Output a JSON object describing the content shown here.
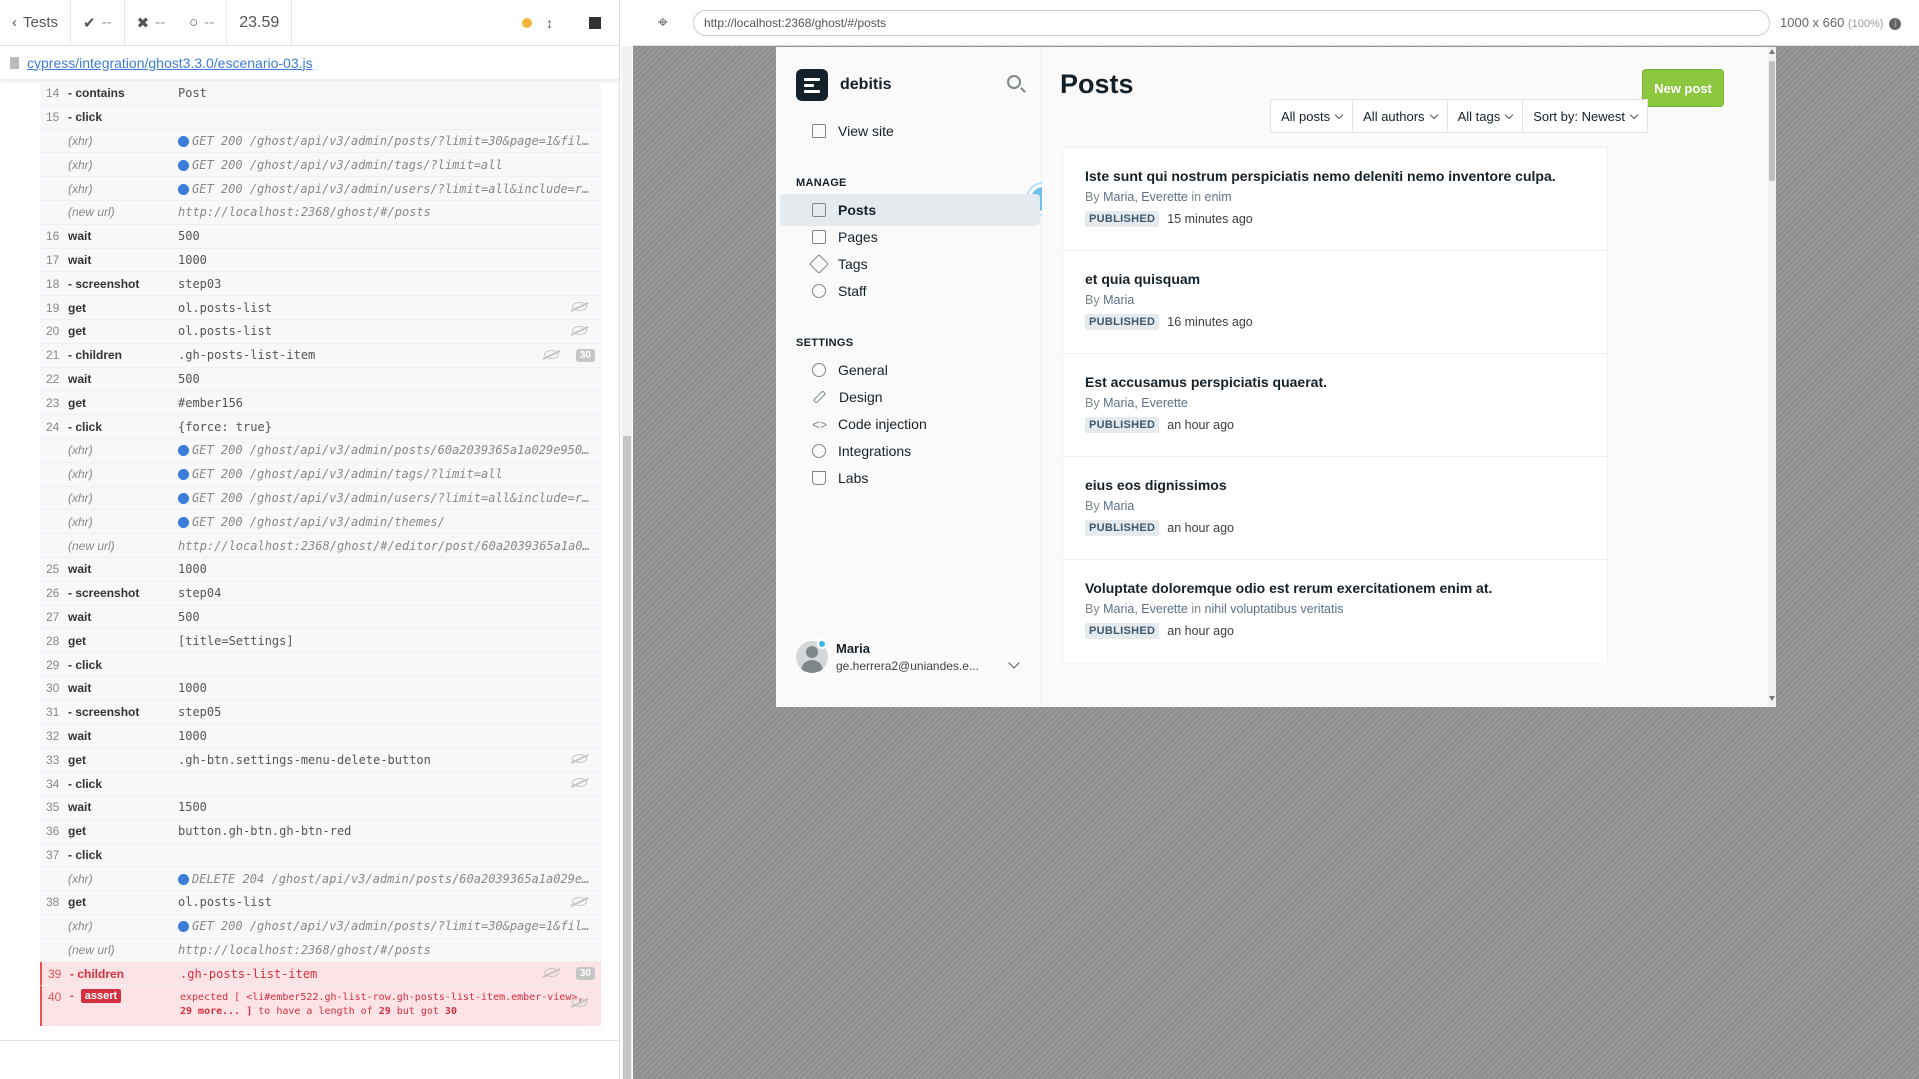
{
  "runner": {
    "tests_label": "Tests",
    "passed": "--",
    "failed": "--",
    "pending": "--",
    "duration": "23.59",
    "spec_path": "cypress/integration/ghost3.3.0/escenario-03.js"
  },
  "commands": [
    {
      "n": "14",
      "name": "- contains",
      "msg": "Post",
      "type": "cmd"
    },
    {
      "n": "15",
      "name": "- click",
      "msg": "",
      "type": "cmd"
    },
    {
      "n": "",
      "name": "(xhr)",
      "msg": "GET 200 /ghost/api/v3/admin/posts/?limit=30&page=1&filter=...",
      "type": "xhr"
    },
    {
      "n": "",
      "name": "(xhr)",
      "msg": "GET 200 /ghost/api/v3/admin/tags/?limit=all",
      "type": "xhr"
    },
    {
      "n": "",
      "name": "(xhr)",
      "msg": "GET 200 /ghost/api/v3/admin/users/?limit=all&include=roles",
      "type": "xhr"
    },
    {
      "n": "",
      "name": "(new url)",
      "msg": "http://localhost:2368/ghost/#/posts",
      "type": "url"
    },
    {
      "n": "16",
      "name": "wait",
      "msg": "500",
      "type": "cmd"
    },
    {
      "n": "17",
      "name": "wait",
      "msg": "1000",
      "type": "cmd"
    },
    {
      "n": "18",
      "name": "- screenshot",
      "msg": "step03",
      "type": "cmd"
    },
    {
      "n": "19",
      "name": "get",
      "msg": "ol.posts-list",
      "type": "cmd",
      "eye": true
    },
    {
      "n": "20",
      "name": "get",
      "msg": "ol.posts-list",
      "type": "cmd",
      "eye": true
    },
    {
      "n": "21",
      "name": "- children",
      "msg": ".gh-posts-list-item",
      "type": "cmd",
      "eye": true,
      "badge": "30"
    },
    {
      "n": "22",
      "name": "wait",
      "msg": "500",
      "type": "cmd"
    },
    {
      "n": "23",
      "name": "get",
      "msg": "#ember156",
      "type": "cmd"
    },
    {
      "n": "24",
      "name": "- click",
      "msg": "{force: true}",
      "type": "cmd"
    },
    {
      "n": "",
      "name": "(xhr)",
      "msg": "GET 200 /ghost/api/v3/admin/posts/60a2039365a1a029e950c8a7/",
      "type": "xhr"
    },
    {
      "n": "",
      "name": "(xhr)",
      "msg": "GET 200 /ghost/api/v3/admin/tags/?limit=all",
      "type": "xhr"
    },
    {
      "n": "",
      "name": "(xhr)",
      "msg": "GET 200 /ghost/api/v3/admin/users/?limit=all&include=roles",
      "type": "xhr"
    },
    {
      "n": "",
      "name": "(xhr)",
      "msg": "GET 200 /ghost/api/v3/admin/themes/",
      "type": "xhr"
    },
    {
      "n": "",
      "name": "(new url)",
      "msg": "http://localhost:2368/ghost/#/editor/post/60a2039365a1a029e9...",
      "type": "url"
    },
    {
      "n": "25",
      "name": "wait",
      "msg": "1000",
      "type": "cmd"
    },
    {
      "n": "26",
      "name": "- screenshot",
      "msg": "step04",
      "type": "cmd"
    },
    {
      "n": "27",
      "name": "wait",
      "msg": "500",
      "type": "cmd"
    },
    {
      "n": "28",
      "name": "get",
      "msg": "[title=Settings]",
      "type": "cmd"
    },
    {
      "n": "29",
      "name": "- click",
      "msg": "",
      "type": "cmd"
    },
    {
      "n": "30",
      "name": "wait",
      "msg": "1000",
      "type": "cmd"
    },
    {
      "n": "31",
      "name": "- screenshot",
      "msg": "step05",
      "type": "cmd"
    },
    {
      "n": "32",
      "name": "wait",
      "msg": "1000",
      "type": "cmd"
    },
    {
      "n": "33",
      "name": "get",
      "msg": ".gh-btn.settings-menu-delete-button",
      "type": "cmd",
      "eye": true
    },
    {
      "n": "34",
      "name": "- click",
      "msg": "",
      "type": "cmd",
      "eye": true
    },
    {
      "n": "35",
      "name": "wait",
      "msg": "1500",
      "type": "cmd"
    },
    {
      "n": "36",
      "name": "get",
      "msg": "button.gh-btn.gh-btn-red",
      "type": "cmd"
    },
    {
      "n": "37",
      "name": "- click",
      "msg": "",
      "type": "cmd"
    },
    {
      "n": "",
      "name": "(xhr)",
      "msg": "DELETE 204 /ghost/api/v3/admin/posts/60a2039365a1a029e950c...",
      "type": "xhr"
    },
    {
      "n": "38",
      "name": "get",
      "msg": "ol.posts-list",
      "type": "cmd",
      "eye": true
    },
    {
      "n": "",
      "name": "(xhr)",
      "msg": "GET 200 /ghost/api/v3/admin/posts/?limit=30&page=1&filter=...",
      "type": "xhr"
    },
    {
      "n": "",
      "name": "(new url)",
      "msg": "http://localhost:2368/ghost/#/posts",
      "type": "url"
    },
    {
      "n": "39",
      "name": "- children",
      "msg": ".gh-posts-list-item",
      "type": "err",
      "eye": true,
      "badge": "30"
    }
  ],
  "assert": {
    "n": "40",
    "label": "assert",
    "line1": "expected [ <li#ember522.gh-list-row.gh-posts-list-item.ember-view>,",
    "line2_a": "29 more... ]",
    "line2_b": " to have a length of ",
    "line2_c": "29",
    "line2_d": " but got ",
    "line2_e": "30"
  },
  "browser": {
    "url": "http://localhost:2368/ghost/#/posts",
    "viewport": "1000 x 660",
    "zoom": "(100%)"
  },
  "ghost": {
    "site_name": "debitis",
    "view_site": "View site",
    "manage_heading": "MANAGE",
    "settings_heading": "SETTINGS",
    "manage_items": [
      "Posts",
      "Pages",
      "Tags",
      "Staff"
    ],
    "settings_items": [
      "General",
      "Design",
      "Code injection",
      "Integrations",
      "Labs"
    ],
    "user_name": "Maria",
    "user_email": "ge.herrera2@uniandes.e...",
    "page_title": "Posts",
    "new_post": "New post",
    "filters": [
      "All posts",
      "All authors",
      "All tags",
      "Sort by: Newest"
    ],
    "posts": [
      {
        "title": "Iste sunt qui nostrum perspiciatis nemo deleniti nemo inventore culpa.",
        "by": "By",
        "authors": "Maria, Everette",
        "in": " in ",
        "tag": "enim",
        "status": "PUBLISHED",
        "time": "15 minutes ago"
      },
      {
        "title": "et quia quisquam",
        "by": "By",
        "authors": "Maria",
        "in": "",
        "tag": "",
        "status": "PUBLISHED",
        "time": "16 minutes ago"
      },
      {
        "title": "Est accusamus perspiciatis quaerat.",
        "by": "By",
        "authors": "Maria, Everette",
        "in": "",
        "tag": "",
        "status": "PUBLISHED",
        "time": "an hour ago"
      },
      {
        "title": "eius eos dignissimos",
        "by": "By",
        "authors": "Maria",
        "in": "",
        "tag": "",
        "status": "PUBLISHED",
        "time": "an hour ago"
      },
      {
        "title": "Voluptate doloremque odio est rerum exercitationem enim at.",
        "by": "By",
        "authors": "Maria, Everette",
        "in": " in ",
        "tag": "nihil voluptatibus veritatis",
        "status": "PUBLISHED",
        "time": "an hour ago"
      }
    ]
  },
  "colors": {
    "accent_green": "#8dc63f",
    "error_red": "#d5303f",
    "link_blue": "#3b7dd8"
  }
}
